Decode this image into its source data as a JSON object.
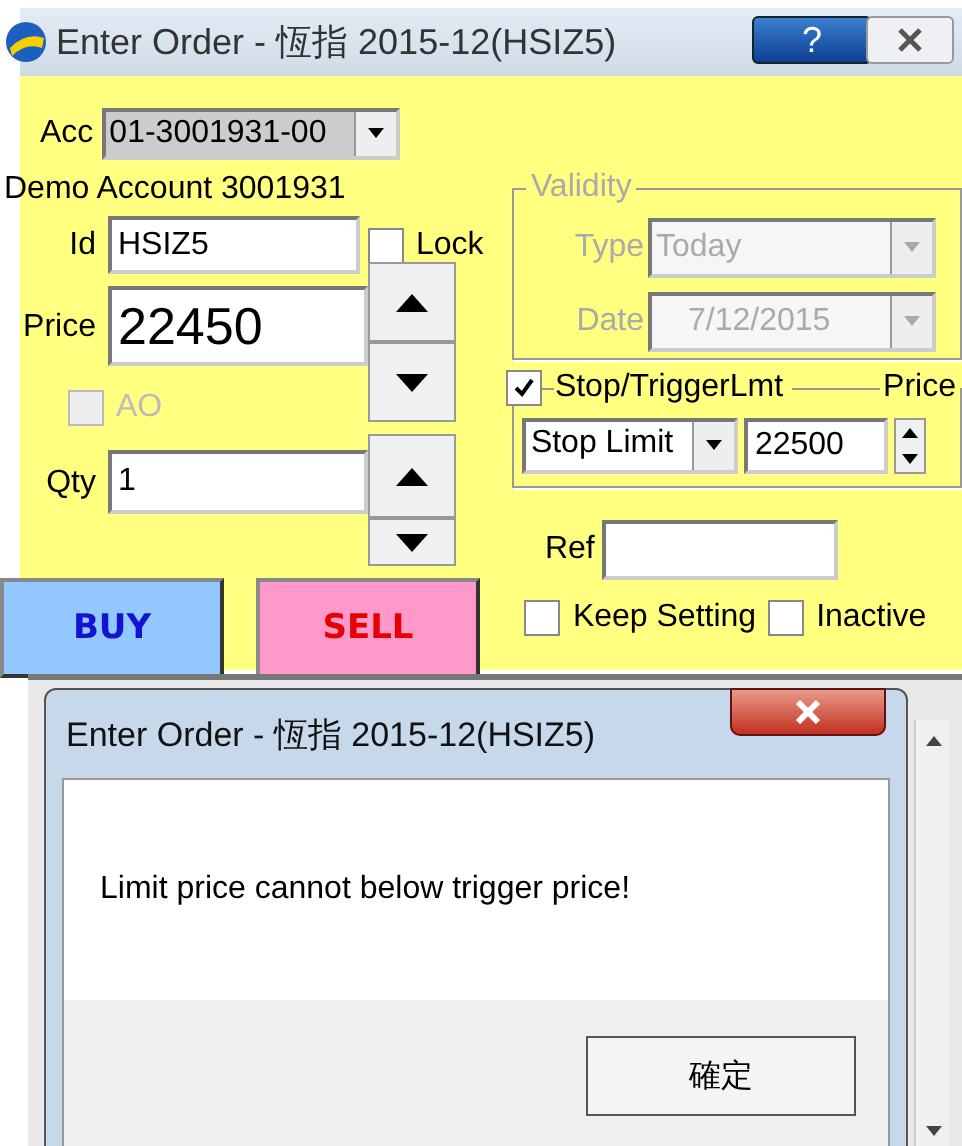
{
  "window": {
    "title": "Enter Order - 恆指 2015-12(HSIZ5)",
    "help_button": "?"
  },
  "account": {
    "label": "Acc",
    "value": "01-3001931-00"
  },
  "account_name": "Demo Account 3001931",
  "id": {
    "label": "Id",
    "value": "HSIZ5"
  },
  "lock": {
    "label": "Lock",
    "checked": false
  },
  "price": {
    "label": "Price",
    "value": "22450"
  },
  "ao": {
    "label": "AO",
    "checked": false,
    "disabled": true
  },
  "qty": {
    "label": "Qty",
    "value": "1"
  },
  "buy_button": "BUY",
  "sell_button": "SELL",
  "validity": {
    "title": "Validity",
    "disabled": true,
    "type": {
      "label": "Type",
      "value": "Today"
    },
    "date": {
      "label": "Date",
      "value": "7/12/2015"
    }
  },
  "stop": {
    "label": "Stop/TriggerLmt",
    "checked": true,
    "price_label": "Price",
    "order_type": "Stop Limit",
    "trigger_price": "22500"
  },
  "ref": {
    "label": "Ref"
  },
  "keep_setting": {
    "label": "Keep Setting",
    "checked": false
  },
  "inactive": {
    "label": "Inactive",
    "checked": false
  },
  "dialog": {
    "title": "Enter Order - 恆指 2015-12(HSIZ5)",
    "message": "Limit price cannot below trigger price!",
    "ok_button": "確定"
  }
}
